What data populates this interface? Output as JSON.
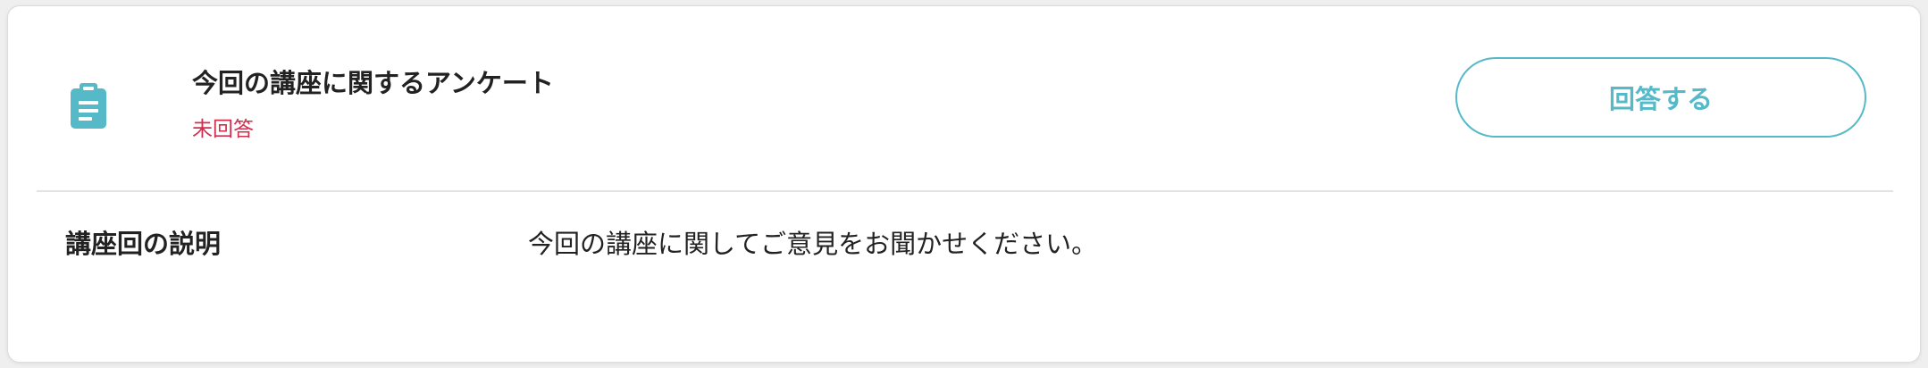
{
  "survey": {
    "title": "今回の講座に関するアンケート",
    "status": "未回答",
    "answer_button_label": "回答する",
    "icon": "clipboard-icon"
  },
  "description": {
    "label": "講座回の説明",
    "text": "今回の講座に関してご意見をお聞かせください。"
  },
  "colors": {
    "accent": "#56b9c8",
    "status_unanswered": "#d12f4f",
    "text": "#222222"
  }
}
